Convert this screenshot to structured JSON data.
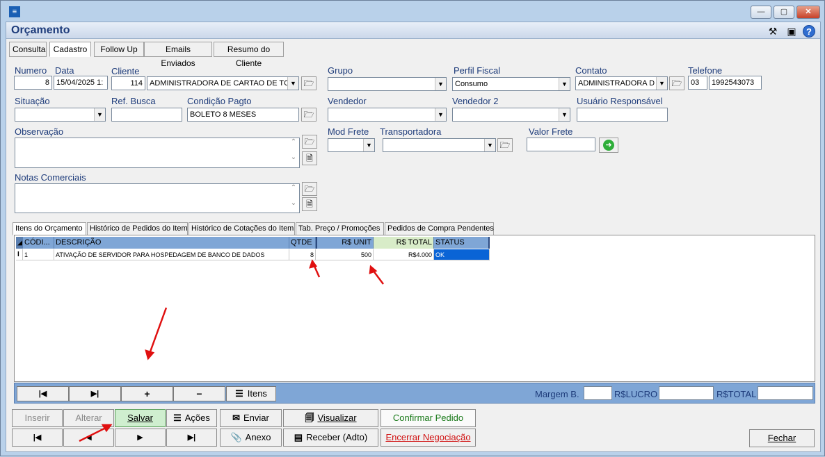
{
  "window": {
    "app_icon": "app-icon",
    "minimize_icon": "minimize-icon",
    "maximize_icon": "maximize-icon",
    "close_icon": "close-icon"
  },
  "header": {
    "title": "Orçamento",
    "icons": [
      "tools-icon",
      "save-icon",
      "help-icon"
    ]
  },
  "tabs": [
    "Consulta",
    "Cadastro",
    "Follow Up",
    "Emails Enviados",
    "Resumo do Cliente"
  ],
  "active_tab": "Cadastro",
  "form": {
    "numero_label": "Numero",
    "numero_value": "8",
    "data_label": "Data",
    "data_value": "15/04/2025 1:",
    "cliente_label": "Cliente",
    "cliente_code": "114",
    "cliente_name": "ADMINISTRADORA DE CARTAO DE TC",
    "grupo_label": "Grupo",
    "grupo_value": "",
    "perfil_label": "Perfil Fiscal",
    "perfil_value": "Consumo",
    "contato_label": "Contato",
    "contato_value": "ADMINISTRADORA D",
    "telefone_label": "Telefone",
    "telefone_ddd": "03",
    "telefone_number": "1992543073",
    "situacao_label": "Situação",
    "situacao_value": "",
    "refbusca_label": "Ref. Busca",
    "refbusca_value": "",
    "condicao_label": "Condição Pagto",
    "condicao_value": "BOLETO 8 MESES",
    "vendedor_label": "Vendedor",
    "vendedor_value": "",
    "vendedor2_label": "Vendedor 2",
    "vendedor2_value": "",
    "usuario_label": "Usuário Responsável",
    "usuario_value": "",
    "observacao_label": "Observação",
    "modfrete_label": "Mod Frete",
    "modfrete_value": "",
    "transportadora_label": "Transportadora",
    "transportadora_value": "",
    "valorfrete_label": "Valor Frete",
    "valorfrete_value": "",
    "notas_label": "Notas Comerciais"
  },
  "item_tabs": [
    "Itens do Orçamento",
    "Histórico de Pedidos do Item",
    "Histórico de Cotações do Item",
    "Tab. Preço / Promoções",
    "Pedidos de Compra Pendentes"
  ],
  "grid": {
    "columns": [
      "CÓDI...",
      "DESCRIÇÃO",
      "QTDE",
      "R$ UNIT",
      "R$ TOTAL",
      "STATUS"
    ],
    "rows": [
      {
        "indicator": "I",
        "code": "1",
        "description": "ATIVAÇÃO DE SERVIDOR PARA HOSPEDAGEM DE BANCO DE DADOS",
        "qtde": "8",
        "unit": "500",
        "total": "R$4.000",
        "status": "OK"
      }
    ]
  },
  "nav": {
    "first": "|◀",
    "last": "▶|",
    "add": "+",
    "remove": "−",
    "itens_label": "Itens",
    "margem_label": "Margem B.",
    "margem_value": "",
    "lucro_label": "R$LUCRO",
    "lucro_value": "",
    "total_label": "R$TOTAL",
    "total_value": ""
  },
  "buttons": {
    "inserir": "Inserir",
    "alterar": "Alterar",
    "salvar": "Salvar",
    "acoes": "Ações",
    "enviar": "Enviar",
    "visualizar": "Visualizar",
    "confirmar": "Confirmar Pedido",
    "first": "|◀",
    "prev": "◀",
    "next": "▶",
    "last": "▶|",
    "anexo": "Anexo",
    "receber": "Receber (Adto)",
    "encerrar": "Encerrar Negociação",
    "fechar": "Fechar"
  },
  "colors": {
    "title": "#1d3b7a",
    "grid_header": "#7fa6d6",
    "status_ok": "#0a64d6",
    "annotation_arrow": "#e01010",
    "salvar_bg": "#cfeecf",
    "encerrar_text": "#d01010"
  }
}
